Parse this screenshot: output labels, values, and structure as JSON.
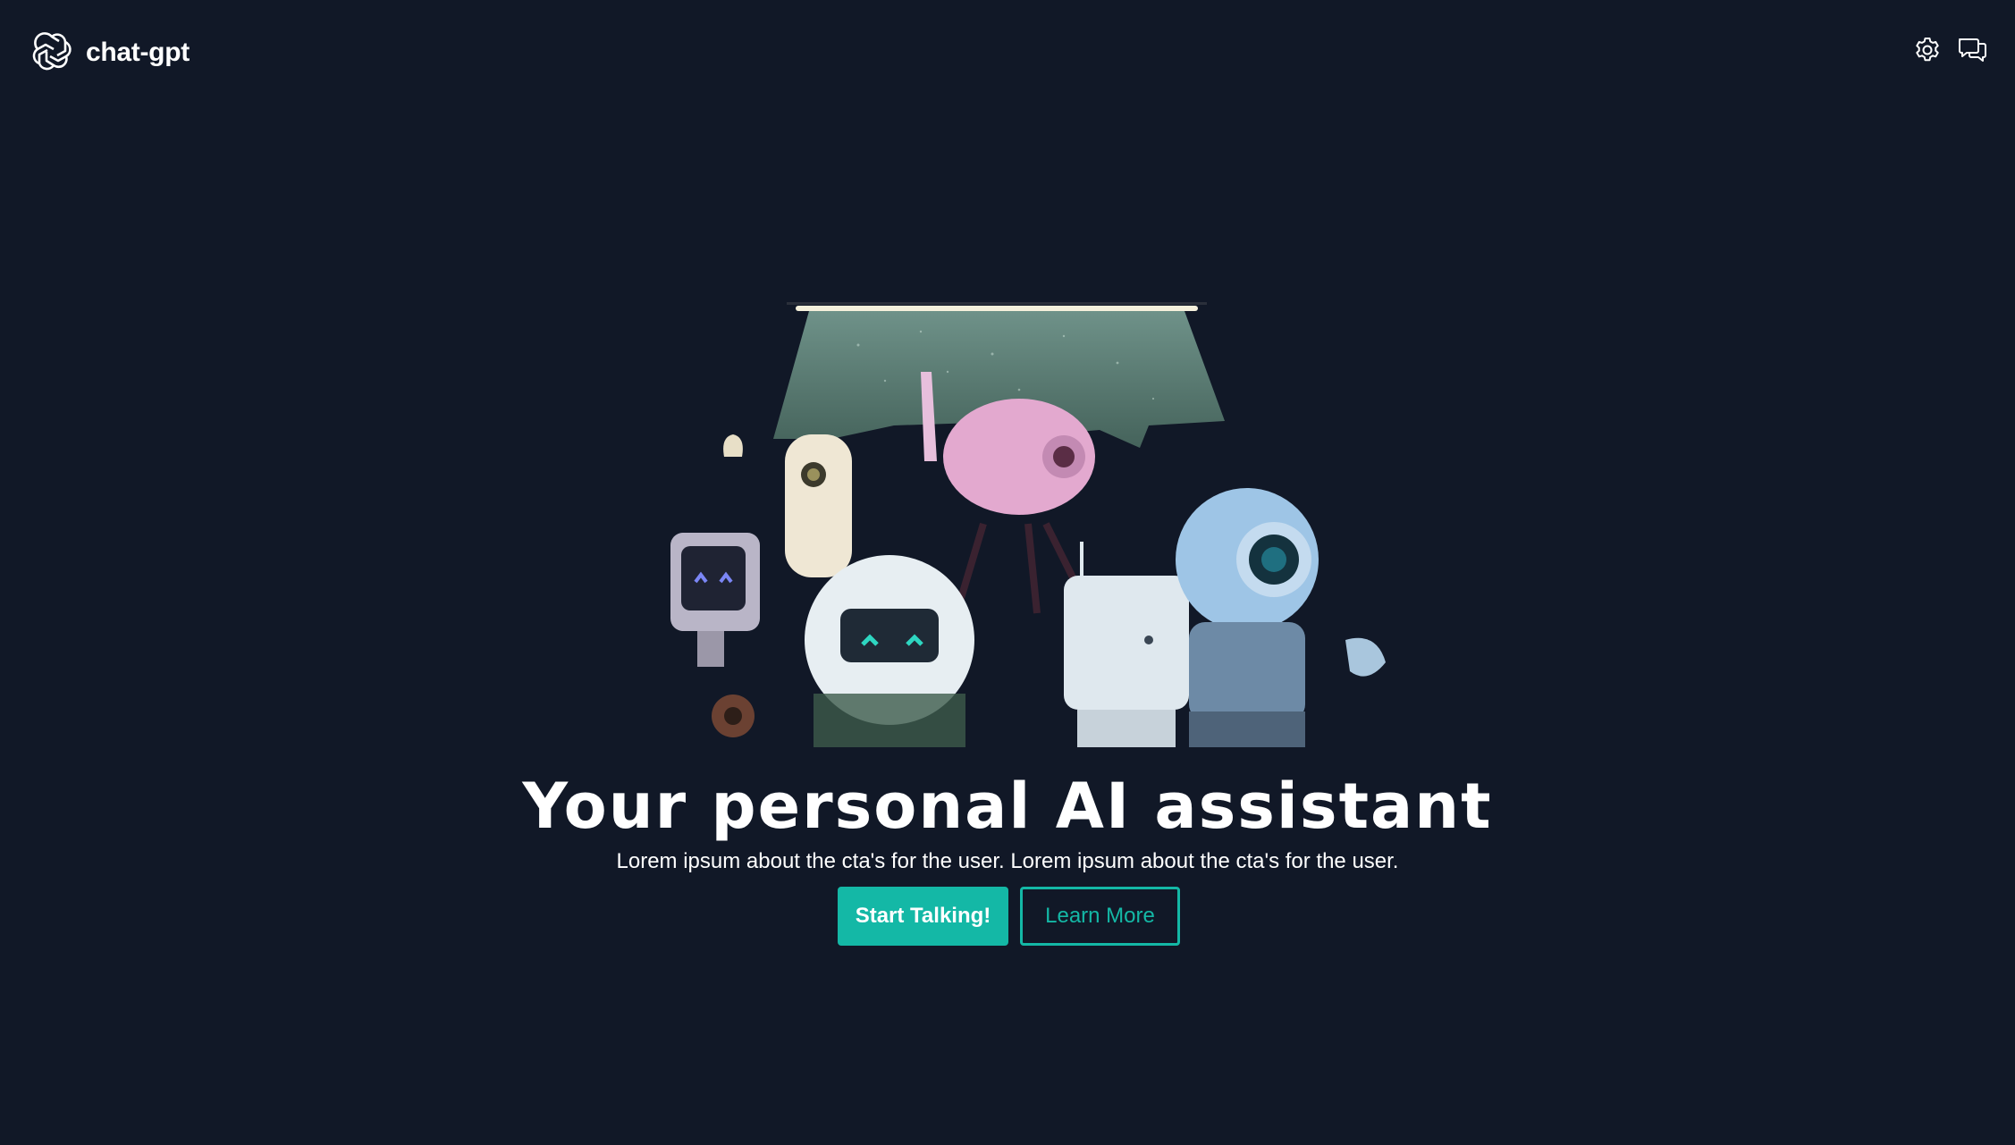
{
  "header": {
    "brand_name": "chat-gpt",
    "logo_icon": "openai-logo-icon",
    "actions": [
      {
        "icon": "gear-icon",
        "label": "settings"
      },
      {
        "icon": "chat-bubbles-icon",
        "label": "chats"
      }
    ]
  },
  "hero": {
    "illustration": "robots-group-illustration",
    "title": "Your personal AI assistant",
    "subtitle": "Lorem ipsum about the cta's for the user. Lorem ipsum about the cta's for the user."
  },
  "cta": {
    "primary_label": "Start Talking!",
    "secondary_label": "Learn More"
  },
  "colors": {
    "background": "#111827",
    "accent": "#14b8a6",
    "text": "#ffffff"
  }
}
